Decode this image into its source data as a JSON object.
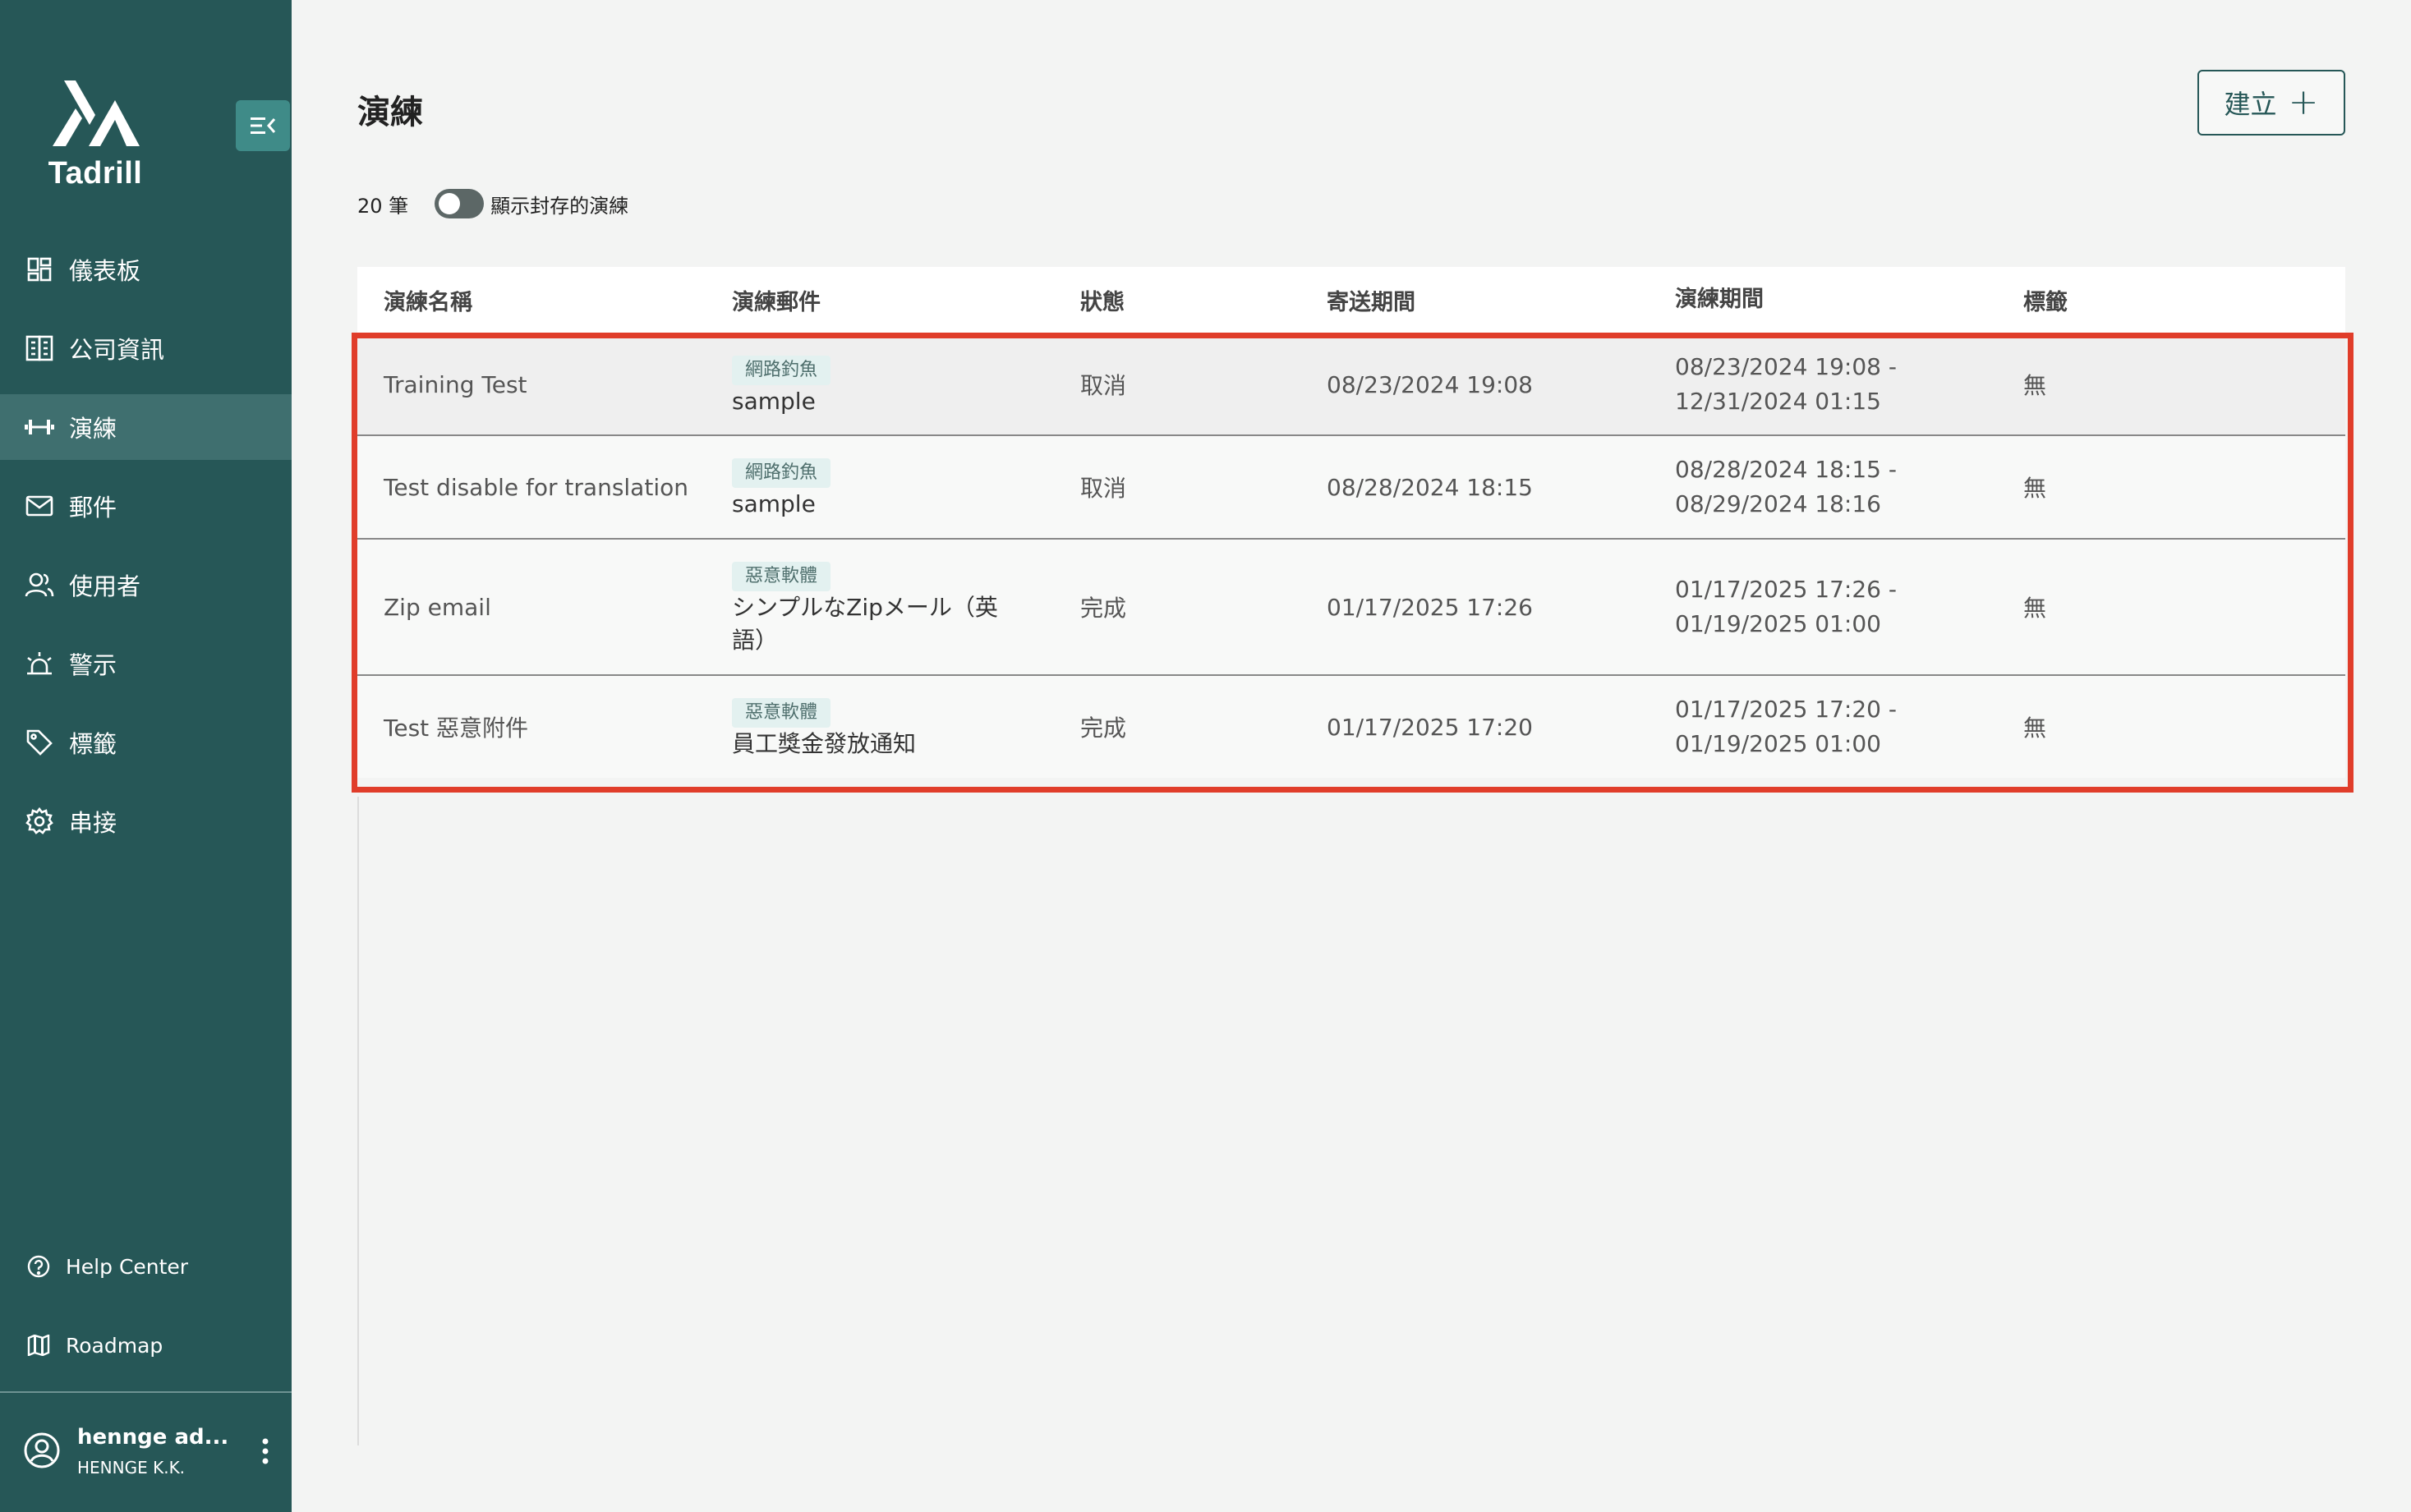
{
  "app": {
    "name": "Tadrill"
  },
  "sidebar": {
    "items": [
      {
        "label": "儀表板",
        "icon": "dashboard-icon",
        "active": false
      },
      {
        "label": "公司資訊",
        "icon": "building-icon",
        "active": false
      },
      {
        "label": "演練",
        "icon": "dumbbell-icon",
        "active": true
      },
      {
        "label": "郵件",
        "icon": "mail-icon",
        "active": false
      },
      {
        "label": "使用者",
        "icon": "users-icon",
        "active": false
      },
      {
        "label": "警示",
        "icon": "alert-icon",
        "active": false
      },
      {
        "label": "標籤",
        "icon": "tag-icon",
        "active": false
      },
      {
        "label": "串接",
        "icon": "gear-icon",
        "active": false
      }
    ],
    "bottom_links": [
      {
        "label": "Help Center",
        "icon": "help-icon"
      },
      {
        "label": "Roadmap",
        "icon": "map-icon"
      }
    ],
    "user": {
      "name": "hennge ad...",
      "org": "HENNGE K.K."
    }
  },
  "header": {
    "title": "演練",
    "create_label": "建立"
  },
  "toolbar": {
    "count": "20 筆",
    "toggle_label": "顯示封存的演練",
    "toggle_on": false
  },
  "table": {
    "columns": [
      "演練名稱",
      "演練郵件",
      "狀態",
      "寄送期間",
      "演練期間",
      "標籤"
    ],
    "rows": [
      {
        "name": "Training Test",
        "mail_tag": "網路釣魚",
        "mail_name": "sample",
        "status": "取消",
        "send_period": "08/23/2024 19:08",
        "drill_period_start": "08/23/2024 19:08 -",
        "drill_period_end": "12/31/2024 01:15",
        "tags": "無"
      },
      {
        "name": "Test disable for translation",
        "mail_tag": "網路釣魚",
        "mail_name": "sample",
        "status": "取消",
        "send_period": "08/28/2024 18:15",
        "drill_period_start": "08/28/2024 18:15 -",
        "drill_period_end": "08/29/2024 18:16",
        "tags": "無"
      },
      {
        "name": "Zip email",
        "mail_tag": "惡意軟體",
        "mail_name": "シンプルなZipメール（英語）",
        "status": "完成",
        "send_period": "01/17/2025 17:26",
        "drill_period_start": "01/17/2025 17:26 -",
        "drill_period_end": "01/19/2025 01:00",
        "tags": "無"
      },
      {
        "name": "Test 惡意附件",
        "mail_tag": "惡意軟體",
        "mail_name": "員工獎金發放通知",
        "status": "完成",
        "send_period": "01/17/2025 17:20",
        "drill_period_start": "01/17/2025 17:20 -",
        "drill_period_end": "01/19/2025 01:00",
        "tags": "無"
      }
    ]
  },
  "colors": {
    "sidebar_bg": "#265757",
    "accent": "#265757",
    "highlight": "#e03d2a",
    "tag_bg": "#e3f1f0"
  }
}
